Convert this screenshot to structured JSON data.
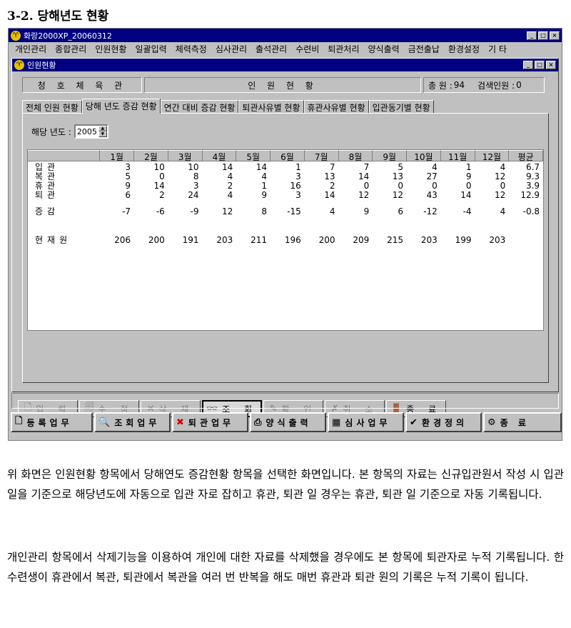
{
  "heading": "3-2. 당해년도 현황",
  "app": {
    "title": "화랑2000XP_20060312",
    "menu": [
      "개인관리",
      "종합관리",
      "인원현황",
      "일괄입력",
      "체력측정",
      "심사관리",
      "출석관리",
      "수련비",
      "퇴관처리",
      "양식출력",
      "금전출납",
      "환경설정",
      "기 타"
    ]
  },
  "child": {
    "title": "인원현황",
    "org": "청 호 체 육 관",
    "screen_title": "인 원 현 황",
    "total_label": "총 원 :",
    "total_value": "94",
    "search_label": "검색인원 :",
    "search_value": "0"
  },
  "tabs": [
    "전체 인원 현황",
    "당해 년도 증감 현황",
    "연간 대비 증감 현황",
    "퇴관사유별 현황",
    "휴관사유별 현황",
    "입관동기별 현황"
  ],
  "active_tab": "당해 년도 증감 현황",
  "year": {
    "label": "해당 년도 :",
    "value": "2005"
  },
  "table": {
    "headers": [
      "",
      "1월",
      "2월",
      "3월",
      "4월",
      "5월",
      "6월",
      "7월",
      "8월",
      "9월",
      "10월",
      "11월",
      "12월",
      "평균"
    ],
    "rows": {
      "in": {
        "label": "입관",
        "values": [
          "3",
          "10",
          "10",
          "14",
          "14",
          "1",
          "7",
          "7",
          "5",
          "4",
          "1",
          "4",
          "6.7"
        ]
      },
      "ret": {
        "label": "복관",
        "values": [
          "5",
          "0",
          "8",
          "4",
          "4",
          "3",
          "13",
          "14",
          "13",
          "27",
          "9",
          "12",
          "9.3"
        ]
      },
      "rest": {
        "label": "휴관",
        "values": [
          "9",
          "14",
          "3",
          "2",
          "1",
          "16",
          "2",
          "0",
          "0",
          "0",
          "0",
          "0",
          "3.9"
        ]
      },
      "out": {
        "label": "퇴관",
        "values": [
          "6",
          "2",
          "24",
          "4",
          "9",
          "3",
          "14",
          "12",
          "12",
          "43",
          "14",
          "12",
          "12.9"
        ]
      },
      "diff": {
        "label": "증감",
        "values": [
          "-7",
          "-6",
          "-9",
          "12",
          "8",
          "-15",
          "4",
          "9",
          "6",
          "-12",
          "-4",
          "4",
          "-0.8"
        ]
      },
      "cur": {
        "label": "현재원",
        "values": [
          "206",
          "200",
          "191",
          "203",
          "211",
          "196",
          "200",
          "209",
          "215",
          "203",
          "199",
          "203",
          ""
        ]
      }
    }
  },
  "commands": {
    "input": "입 력",
    "edit": "수 정",
    "delete": "삭 제",
    "search": "조 회",
    "confirm": "확 인",
    "cancel": "취 소",
    "exit": "종 료"
  },
  "bottom": {
    "register": "등록업무",
    "query": "조회업무",
    "leave": "퇴관업무",
    "print": "양식출력",
    "review": "심사업무",
    "settings": "환경정의",
    "exit": "종     료"
  },
  "paragraphs": [
    "위 화면은 인원현황 항목에서 당해연도 증감현황 항목을 선택한 화면입니다. 본 항목의 자료는 신규입관원서 작성 시 입관 일을 기준으로 해당년도에 자동으로 입관 자로 잡히고 휴관, 퇴관 일 경우는 휴관, 퇴관 일 기준으로 자동 기록됩니다.",
    "개인관리 항목에서 삭제기능을 이용하여 개인에 대한 자료를 삭제했을 경우에도 본 항목에 퇴관자로 누적 기록됩니다. 한 수련생이 휴관에서 복관, 퇴관에서 복관을 여러 번 반복을 해도 매번 휴관과 퇴관 원의 기록은 누적 기록이 됩니다."
  ]
}
